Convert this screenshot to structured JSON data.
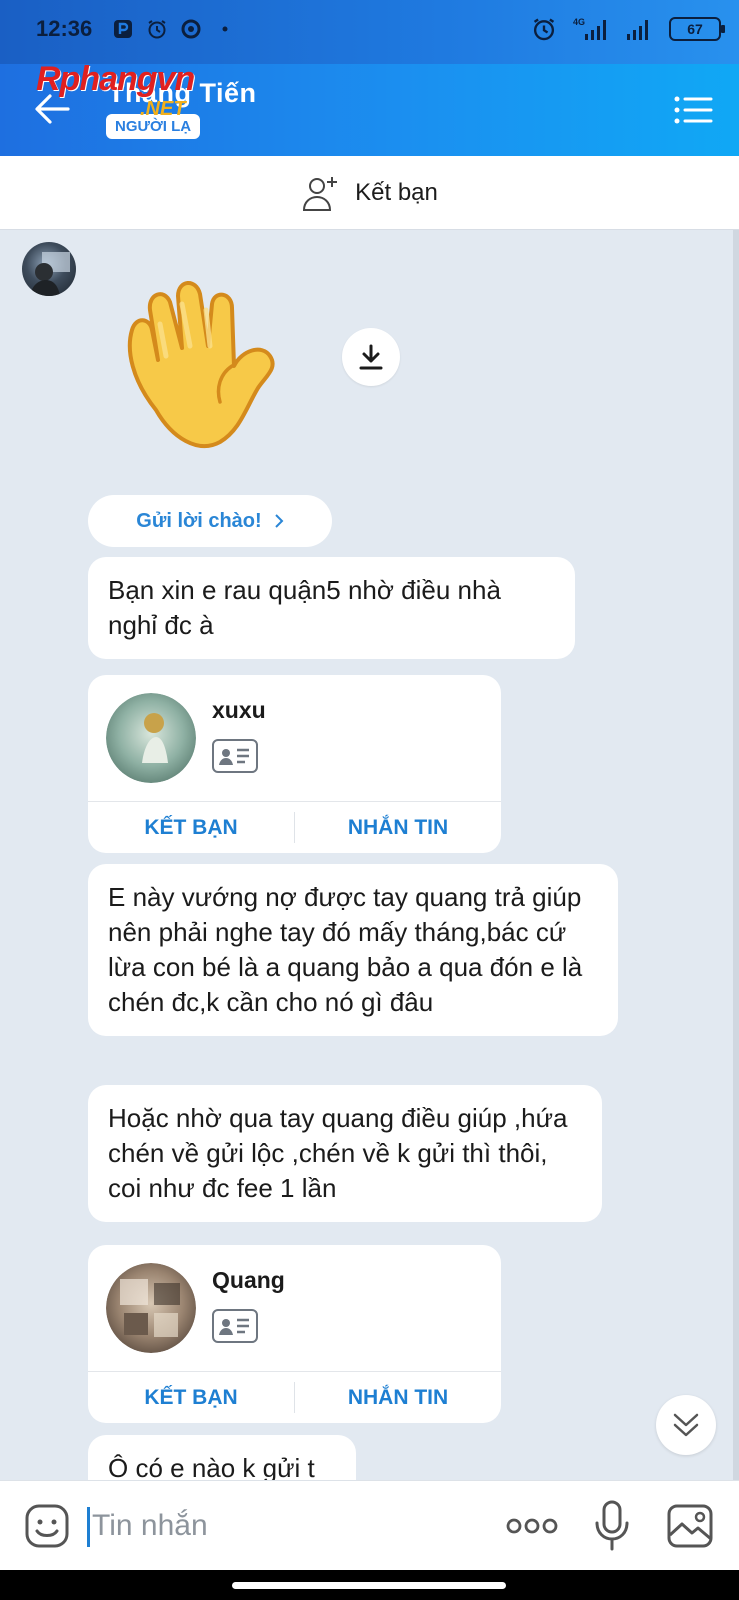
{
  "status_bar": {
    "time": "12:36",
    "network": "4G",
    "battery": "67"
  },
  "header": {
    "contact_name": "Tháng Tiến",
    "badge": "NGƯỜI LẠ",
    "watermark": "Rphangvn",
    "watermark_sub": ".NET"
  },
  "friend_bar": {
    "label": "Kết bạn"
  },
  "chat": {
    "greeting_chip": "Gửi lời chào!",
    "messages": [
      "Bạn xin e rau quận5 nhờ điều nhà nghỉ đc à",
      "E này vướng nợ được tay quang trả giúp nên phải nghe tay đó mấy tháng,bác cứ lừa con bé là a quang bảo a qua đón e là chén đc,k cần cho nó gì đâu",
      "Hoặc nhờ qua tay quang điều giúp ,hứa chén về gửi lộc ,chén về k gửi thì thôi, coi như đc fee 1 lần",
      "Ô có e nào k gửi t"
    ],
    "cards": [
      {
        "name": "xuxu",
        "add_label": "KẾT BẠN",
        "message_label": "NHẮN TIN"
      },
      {
        "name": "Quang",
        "add_label": "KẾT BẠN",
        "message_label": "NHẮN TIN"
      }
    ]
  },
  "input_bar": {
    "placeholder": "Tin nhắn"
  },
  "colors": {
    "accent": "#1e7fd2",
    "header_start": "#1e6fe0",
    "header_end": "#10a8f5",
    "chat_bg": "#e2e9f1"
  }
}
